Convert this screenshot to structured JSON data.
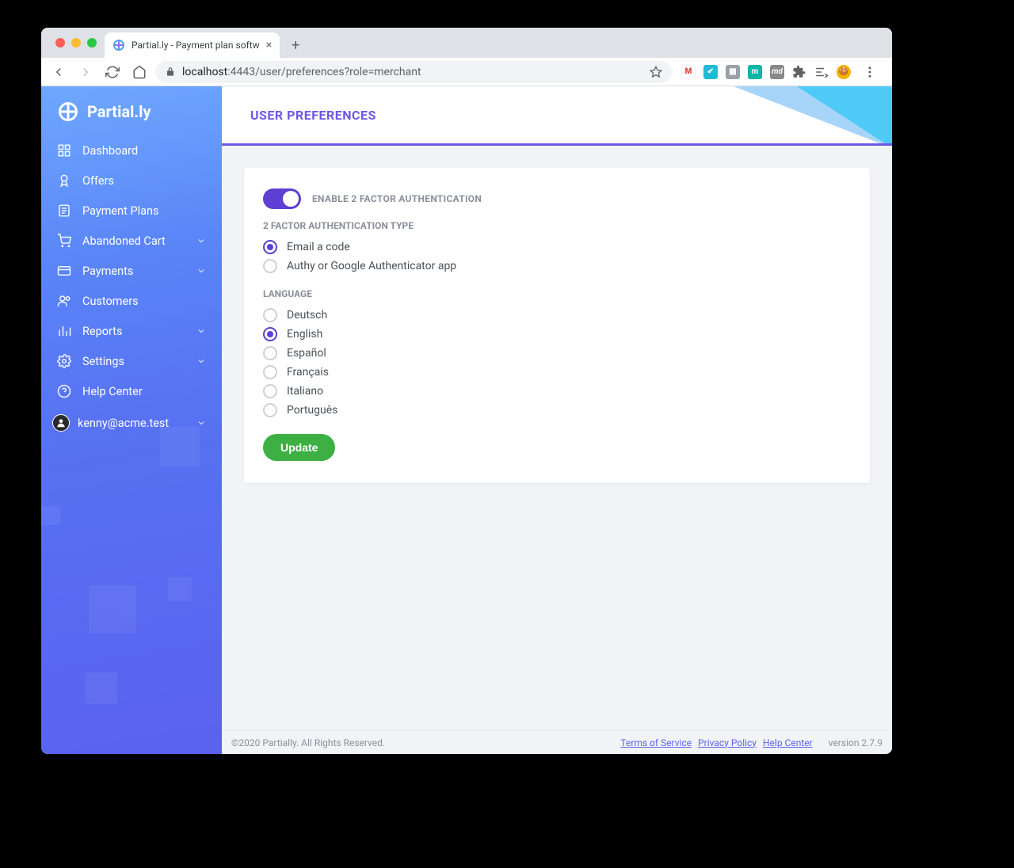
{
  "browser": {
    "tab_title": "Partial.ly - Payment plan softw",
    "url_host": "localhost",
    "url_port": ":4443",
    "url_path": "/user/preferences?role=merchant"
  },
  "brand": "Partial.ly",
  "sidebar": {
    "items": [
      {
        "label": "Dashboard",
        "icon": "dashboard-icon",
        "expandable": false
      },
      {
        "label": "Offers",
        "icon": "offers-icon",
        "expandable": false
      },
      {
        "label": "Payment Plans",
        "icon": "plans-icon",
        "expandable": false
      },
      {
        "label": "Abandoned Cart",
        "icon": "cart-icon",
        "expandable": true
      },
      {
        "label": "Payments",
        "icon": "payments-icon",
        "expandable": true
      },
      {
        "label": "Customers",
        "icon": "customers-icon",
        "expandable": false
      },
      {
        "label": "Reports",
        "icon": "reports-icon",
        "expandable": true
      },
      {
        "label": "Settings",
        "icon": "settings-icon",
        "expandable": true
      },
      {
        "label": "Help Center",
        "icon": "help-icon",
        "expandable": false
      }
    ],
    "user_email": "kenny@acme.test"
  },
  "page": {
    "title": "USER PREFERENCES",
    "toggle_label": "ENABLE 2 FACTOR AUTHENTICATION",
    "toggle_on": true,
    "auth_type_label": "2 FACTOR AUTHENTICATION TYPE",
    "auth_types": [
      {
        "label": "Email a code",
        "checked": true
      },
      {
        "label": "Authy or Google Authenticator app",
        "checked": false
      }
    ],
    "language_label": "LANGUAGE",
    "languages": [
      {
        "label": "Deutsch",
        "checked": false
      },
      {
        "label": "English",
        "checked": true
      },
      {
        "label": "Español",
        "checked": false
      },
      {
        "label": "Français",
        "checked": false
      },
      {
        "label": "Italiano",
        "checked": false
      },
      {
        "label": "Português",
        "checked": false
      }
    ],
    "update_button": "Update"
  },
  "footer": {
    "copyright": "©2020 Partially. All Rights Reserved.",
    "tos": "Terms of Service",
    "privacy": "Privacy Policy",
    "help": "Help Center",
    "version": "version 2.7.9"
  }
}
